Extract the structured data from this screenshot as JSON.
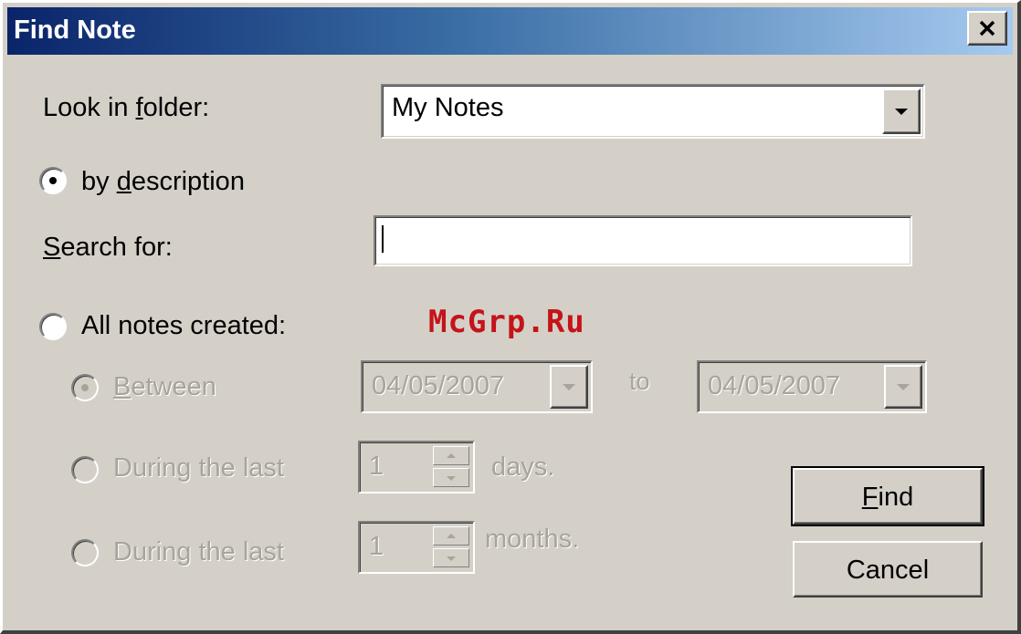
{
  "window": {
    "title": "Find Note",
    "close_label": "close"
  },
  "folder": {
    "label_pre": "Look in ",
    "label_accel": "f",
    "label_post": "older:",
    "selected": "My Notes"
  },
  "by_description": {
    "label_pre": "by ",
    "label_accel": "d",
    "label_post": "escription",
    "checked": true
  },
  "search": {
    "label_accel": "S",
    "label_post": "earch for:",
    "value": ""
  },
  "all_notes": {
    "label": "All notes created:",
    "checked": false
  },
  "between": {
    "label_accel": "B",
    "label_post": "etween",
    "from": "04/05/2007",
    "to_label": "to",
    "to": "04/05/2007"
  },
  "days_row": {
    "label": "During the last",
    "value": "1",
    "unit": "days."
  },
  "months_row": {
    "label": "During the last",
    "value": "1",
    "unit": "months."
  },
  "buttons": {
    "find_accel": "F",
    "find_post": "ind",
    "cancel": "Cancel"
  },
  "watermark": "McGrp.Ru"
}
